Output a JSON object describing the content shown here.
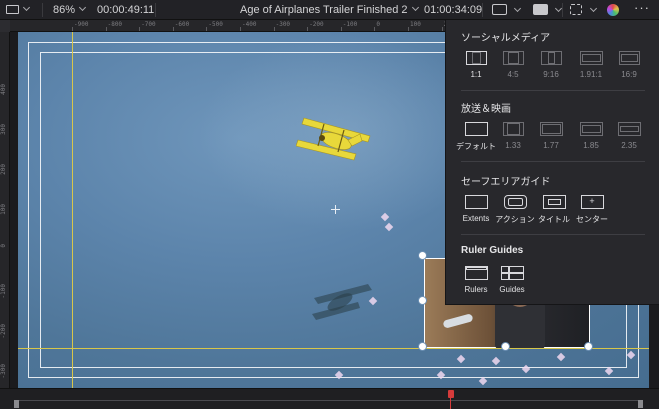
{
  "toolbar": {
    "zoom": "86%",
    "source_timecode": "00:00:49:11",
    "timeline_name": "Age of Airplanes Trailer Finished 2",
    "record_timecode": "01:00:34:09"
  },
  "ruler_top_labels": [
    "-900",
    "-800",
    "-700",
    "-600",
    "-500",
    "-400",
    "-300",
    "-200",
    "-100",
    "0",
    "100",
    "200",
    "300",
    "400",
    "500",
    "600",
    "700",
    "800",
    "900"
  ],
  "ruler_left_labels": [
    "400",
    "300",
    "200",
    "100",
    "0",
    "-100",
    "-200",
    "-300",
    "-400"
  ],
  "popup": {
    "social": {
      "title": "ソーシャルメディア",
      "options": [
        "1:1",
        "4:5",
        "9:16",
        "1.91:1",
        "16:9"
      ]
    },
    "broadcast": {
      "title": "放送＆映画",
      "options": [
        "デフォルト",
        "1.33",
        "1.77",
        "1.85",
        "2.35"
      ]
    },
    "safe": {
      "title": "セーフエリアガイド",
      "options": [
        "Extents",
        "アクション",
        "タイトル",
        "センター"
      ]
    },
    "ruler_guides": {
      "title": "Ruler Guides",
      "options": [
        "Rulers",
        "Guides"
      ]
    }
  },
  "colors": {
    "accent_yellow": "#d8c64a",
    "playhead_red": "#d63b3b",
    "popup_bg": "#28282c"
  },
  "icons": [
    "monitor-layout-icon",
    "scope-icon",
    "safe-area-icon",
    "transform-icon",
    "color-wheel-icon",
    "more-icon"
  ]
}
